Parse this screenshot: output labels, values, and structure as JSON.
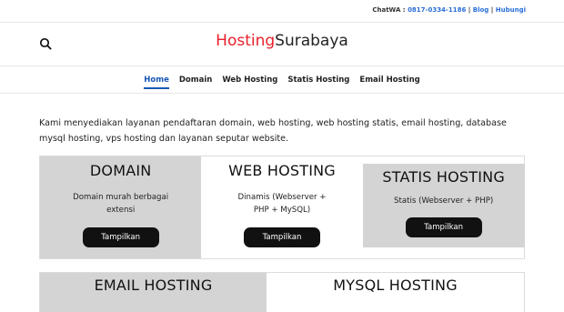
{
  "topbar": {
    "chatwa_label": "ChatWA :",
    "phone": "0817-0334-1186",
    "sep1": " | ",
    "blog": "Blog",
    "sep2": " | ",
    "hubungi": "Hubungi"
  },
  "header": {
    "logo_part1": "Hosting",
    "logo_part2": "Surabaya"
  },
  "nav": {
    "items": [
      {
        "label": "Home"
      },
      {
        "label": "Domain"
      },
      {
        "label": "Web Hosting"
      },
      {
        "label": "Statis Hosting"
      },
      {
        "label": "Email Hosting"
      }
    ]
  },
  "intro": "Kami menyediakan layanan pendaftaran domain, web hosting, web hosting statis, email hosting, database mysql hosting, vps hosting dan layanan seputar website.",
  "services": [
    {
      "title": "DOMAIN",
      "desc": "Domain murah berbagai extensi",
      "button": "Tampilkan"
    },
    {
      "title": "WEB HOSTING",
      "desc": "Dinamis (Webserver + PHP + MySQL)",
      "button": "Tampilkan"
    },
    {
      "title": "STATIS HOSTING",
      "desc": "Statis (Webserver + PHP)",
      "button": "Tampilkan"
    },
    {
      "title": "EMAIL HOSTING"
    },
    {
      "title": "MYSQL HOSTING"
    }
  ],
  "colors": {
    "accent": "#1a57b5",
    "logo_red": "#e8202a",
    "button": "#111111",
    "box_gray": "#d4d4d4"
  }
}
